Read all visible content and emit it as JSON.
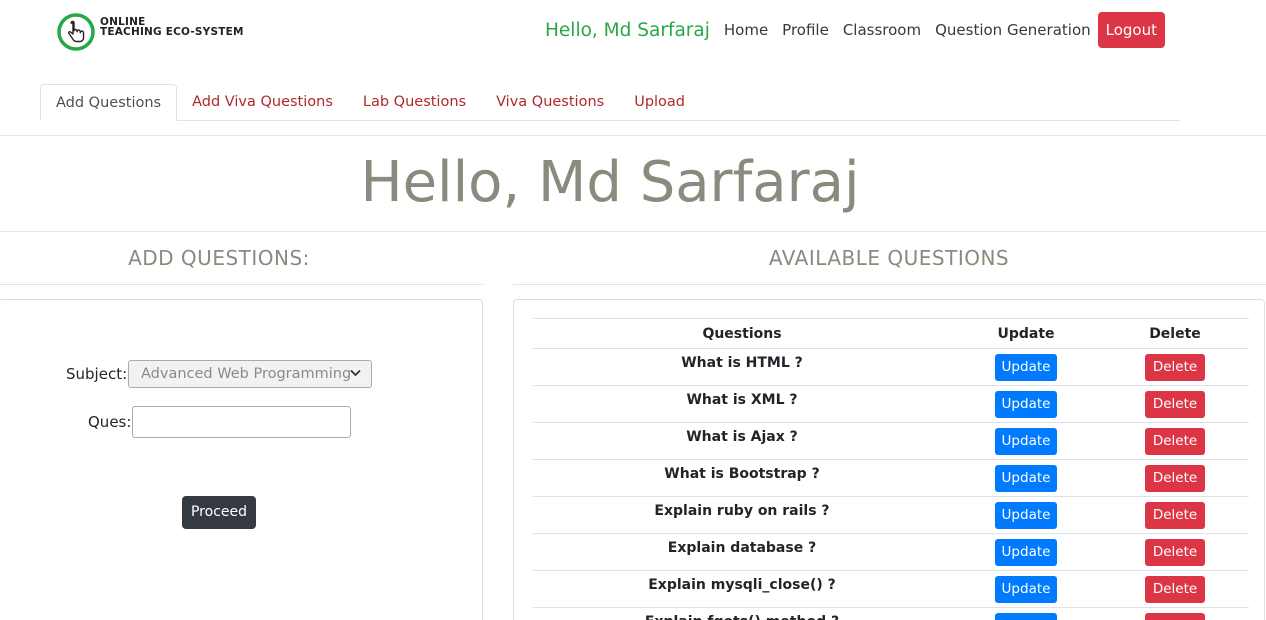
{
  "navbar": {
    "logo_line1": "ONLINE",
    "logo_line2": "TEACHING ECO-SYSTEM",
    "greeting": "Hello, Md Sarfaraj",
    "links": [
      "Home",
      "Profile",
      "Classroom",
      "Question Generation"
    ],
    "logout": "Logout"
  },
  "tabs": [
    "Add Questions",
    "Add Viva Questions",
    "Lab Questions",
    "Viva Questions",
    "Upload"
  ],
  "active_tab": "Add Questions",
  "hero": "Hello, Md Sarfaraj",
  "add_section": {
    "title": "ADD QUESTIONS:",
    "subject_label": "Subject:",
    "subject_value": "Advanced Web Programming",
    "ques_label": "Ques:",
    "ques_value": "",
    "proceed": "Proceed"
  },
  "available": {
    "title": "AVAILABLE QUESTIONS",
    "headers": [
      "Questions",
      "Update",
      "Delete"
    ],
    "update_label": "Update",
    "delete_label": "Delete",
    "rows": [
      "What is HTML ?",
      "What is XML ?",
      "What is Ajax ?",
      "What is Bootstrap ?",
      "Explain ruby on rails ?",
      "Explain database ?",
      "Explain mysqli_close() ?",
      "Explain fgets() method ?"
    ]
  },
  "colors": {
    "greeting": "#28a745",
    "logout": "#dc3545",
    "tab_link": "#b0282e",
    "update": "#007bff",
    "delete": "#dc3545",
    "proceed": "#343a40",
    "heading": "#8a8a7e"
  }
}
